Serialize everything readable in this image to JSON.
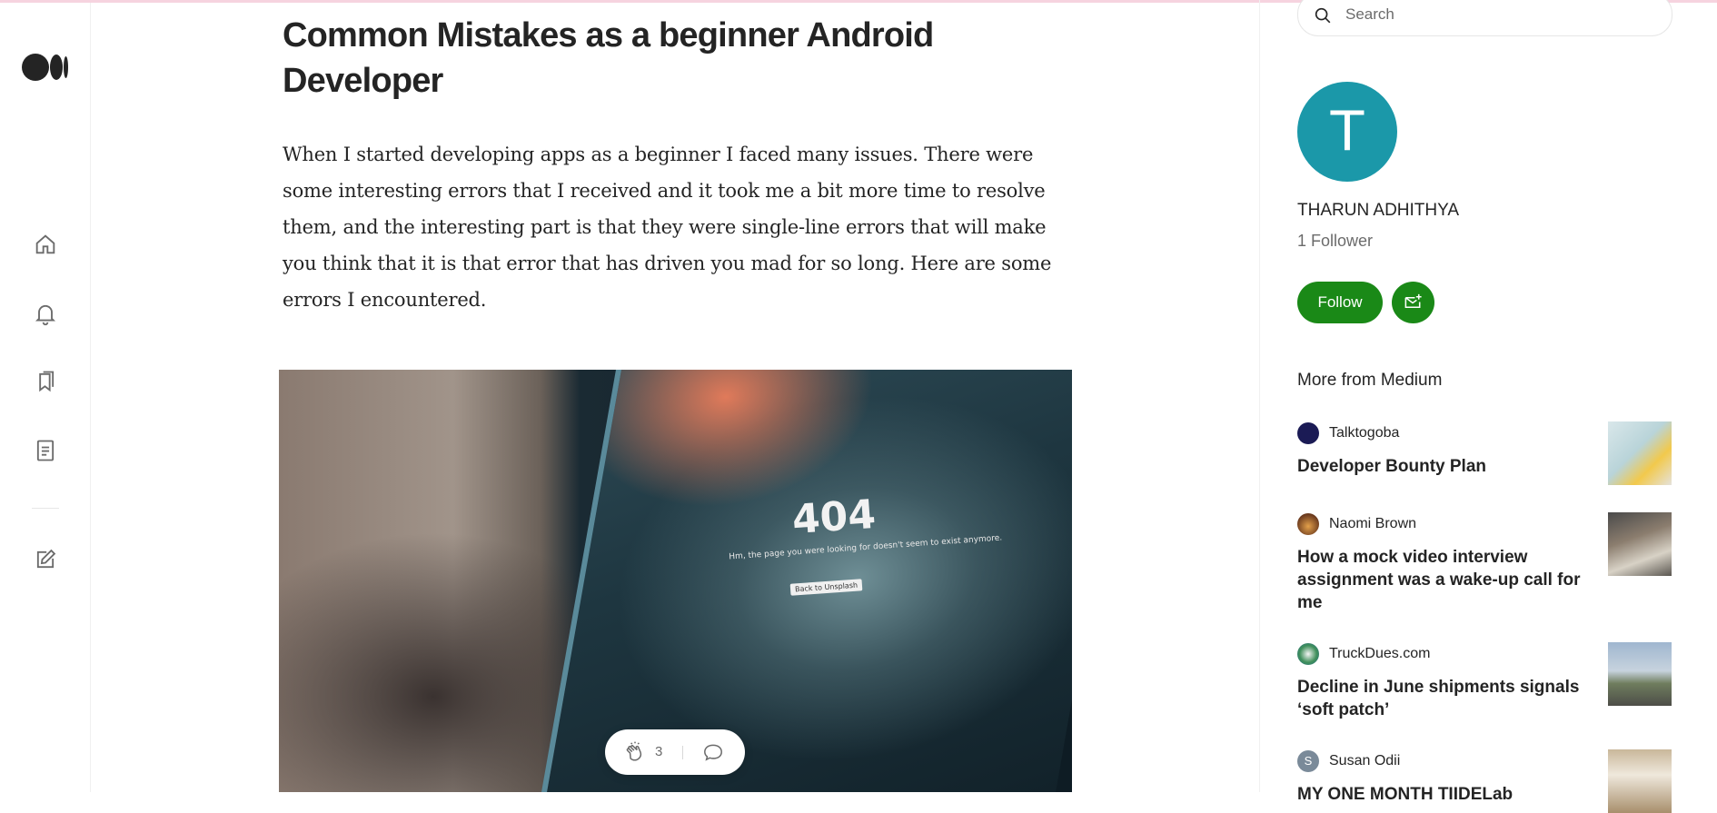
{
  "article": {
    "title": "Common Mistakes as a beginner Android Developer",
    "body": "When I started developing apps as a beginner I faced many issues. There were some interesting errors that I received and it took me a bit more time to resolve them, and the interesting part is that they were single-line errors that will make you think that it is that error that has driven you mad for so long. Here are some errors I encountered.",
    "image": {
      "code": "404",
      "message": "Hm, the page you were looking for doesn't seem to exist anymore.",
      "button": "Back to Unsplash"
    },
    "clap_count": "3"
  },
  "nav": {
    "icons": [
      "home-icon",
      "notifications-icon",
      "bookmarks-icon",
      "stories-icon",
      "write-icon"
    ]
  },
  "sidebar": {
    "search_placeholder": "Search",
    "author": {
      "initial": "T",
      "name": "THARUN ADHITHYA",
      "followers": "1 Follower",
      "avatar_color": "#1b98a9"
    },
    "follow_label": "Follow",
    "more_heading": "More from Medium",
    "recommendations": [
      {
        "publication": "Talktogoba",
        "title": "Developer Bounty Plan"
      },
      {
        "publication": "Naomi Brown",
        "title": "How a mock video interview assignment was a wake-up call for me"
      },
      {
        "publication": "TruckDues.com",
        "title": "Decline in June shipments signals ‘soft patch’"
      },
      {
        "publication": "Susan Odii",
        "title": "MY ONE MONTH TIIDELab"
      }
    ]
  },
  "colors": {
    "accent_green": "#1a8917",
    "text": "#242424",
    "muted": "#6b6b6b"
  }
}
